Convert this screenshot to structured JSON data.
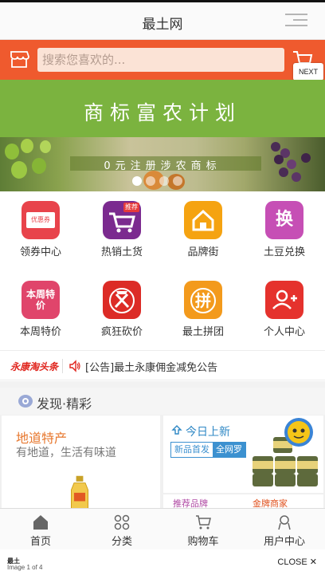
{
  "header": {
    "title": "最土网"
  },
  "search": {
    "placeholder": "搜索您喜欢的..."
  },
  "overlay": {
    "next_label": "NEXT",
    "close_label": "CLOSE",
    "image_counter": "Image 1 of 4",
    "site_label": "最土"
  },
  "banner": {
    "headline": "商标富农计划",
    "slogan": "0元注册涉农商标",
    "slides_total": 4,
    "active_slide": 1
  },
  "grid": [
    {
      "label": "领券中心",
      "icon": "coupon-icon",
      "icon_text": "优惠券",
      "color": "#e8434b"
    },
    {
      "label": "热销土货",
      "icon": "cart-hot-icon",
      "icon_text": "推荐",
      "color": "#7b2a8f"
    },
    {
      "label": "品牌街",
      "icon": "house-icon",
      "icon_text": "",
      "color": "#f5a311"
    },
    {
      "label": "土豆兑换",
      "icon": "exchange-icon",
      "icon_text": "换",
      "color": "#c64fb5"
    },
    {
      "label": "本周特价",
      "icon": "weekly-sale-icon",
      "icon_text": "本周特价",
      "color": "#e0456b"
    },
    {
      "label": "疯狂砍价",
      "icon": "bargain-axe-icon",
      "icon_text": "",
      "color": "#dc2b26"
    },
    {
      "label": "最土拼团",
      "icon": "group-buy-icon",
      "icon_text": "拼",
      "color": "#f39a1c"
    },
    {
      "label": "个人中心",
      "icon": "user-center-icon",
      "icon_text": "",
      "color": "#e5322d"
    }
  ],
  "news": {
    "logo": "永康淘头条",
    "text": "[公告]最土永康佣金减免公告"
  },
  "discover": {
    "title": "发现·精彩"
  },
  "cards": {
    "left_title": "地道特产",
    "left_subtitle": "有地道，生活有味道",
    "right_title": "今日上新",
    "right_tabs": [
      "新品首发",
      "全网罗"
    ],
    "bottom_left": "推荐品牌",
    "bottom_right": "金牌商家"
  },
  "tabbar": [
    {
      "label": "首页",
      "icon": "home-icon"
    },
    {
      "label": "分类",
      "icon": "category-icon"
    },
    {
      "label": "购物车",
      "icon": "cart-icon"
    },
    {
      "label": "用户中心",
      "icon": "user-icon"
    }
  ],
  "colors": {
    "accent": "#ef5a2e",
    "banner_green": "#7bb33f",
    "news_red": "#e0251d"
  }
}
